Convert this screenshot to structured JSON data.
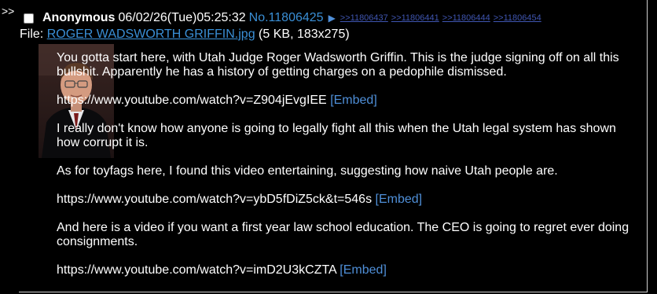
{
  "side_marker": ">>",
  "post": {
    "name": "Anonymous",
    "datetime": "06/02/26(Tue)05:25:32",
    "number": "No.11806425",
    "menu_icon": "triangle-right-icon",
    "menu_glyph": "▶",
    "backlinks": [
      ">>11806437",
      ">>11806441",
      ">>11806444",
      ">>11806454"
    ],
    "file": {
      "label": "File:",
      "filename": "ROGER WADSWORTH GRIFFIN.jpg",
      "info": "(5 KB, 183x275)"
    },
    "paragraphs": [
      {
        "text": "You gotta start here, with Utah Judge Roger Wadsworth Griffin. This is the judge signing off on all this bullshit. Apparently he has a history of getting charges on a pedophile dismissed.",
        "embed": null
      },
      {
        "text": "https://www.youtube.com/watch?v=Z904jEvgIEE",
        "embed": "[Embed]"
      },
      {
        "text": "I really don't know how anyone is going to legally fight all this when the Utah legal system has shown how corrupt it is.",
        "embed": null
      },
      {
        "text": "As for toyfags here, I found this video entertaining, suggesting how naive Utah people are.",
        "embed": null
      },
      {
        "text": "https://www.youtube.com/watch?v=ybD5fDiZ5ck&t=546s",
        "embed": "[Embed]"
      },
      {
        "text": "And here is a video if you want a first year law school education. The CEO is going to regret ever doing consignments.",
        "embed": null
      },
      {
        "text": "https://www.youtube.com/watch?v=imD2U3kCZTA",
        "embed": "[Embed]"
      }
    ]
  },
  "colors": {
    "background": "#000000",
    "text": "#ffffff",
    "link": "#3a8fd6",
    "backlink": "#3f55b0"
  }
}
